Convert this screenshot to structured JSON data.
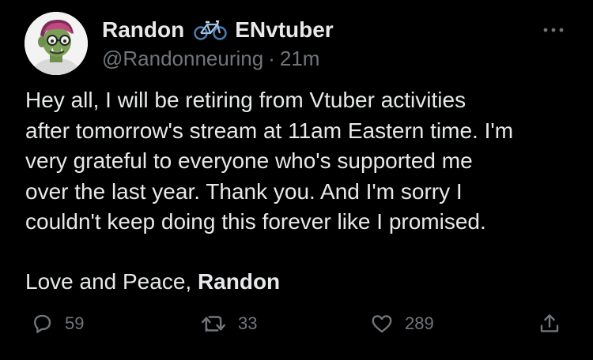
{
  "author": {
    "display_name": "Randon",
    "name_suffix": "ENvtuber",
    "name_emoji_icon": "bicycle-icon",
    "handle": "@Randonneuring",
    "separator": "·",
    "time": "21m"
  },
  "tweet": {
    "lines": [
      "Hey all, I will be retiring from Vtuber activities",
      "after tomorrow's stream at 11am Eastern time. I'm",
      "very grateful to everyone who's supported me",
      "over the last year. Thank you. And I'm sorry I",
      "couldn't keep doing this forever like I promised."
    ],
    "signoff_prefix": "Love and Peace, ",
    "signoff_name": "Randon"
  },
  "actions": {
    "reply": {
      "icon": "reply-icon",
      "count": "59"
    },
    "retweet": {
      "icon": "retweet-icon",
      "count": "33"
    },
    "like": {
      "icon": "heart-icon",
      "count": "289"
    },
    "share": {
      "icon": "share-icon"
    }
  },
  "menu": {
    "icon": "more-options-icon"
  },
  "colors": {
    "background": "#000000",
    "primary_text": "#e7e9ea",
    "secondary_text": "#71767b",
    "bike_blue": "#4a7fb5"
  }
}
